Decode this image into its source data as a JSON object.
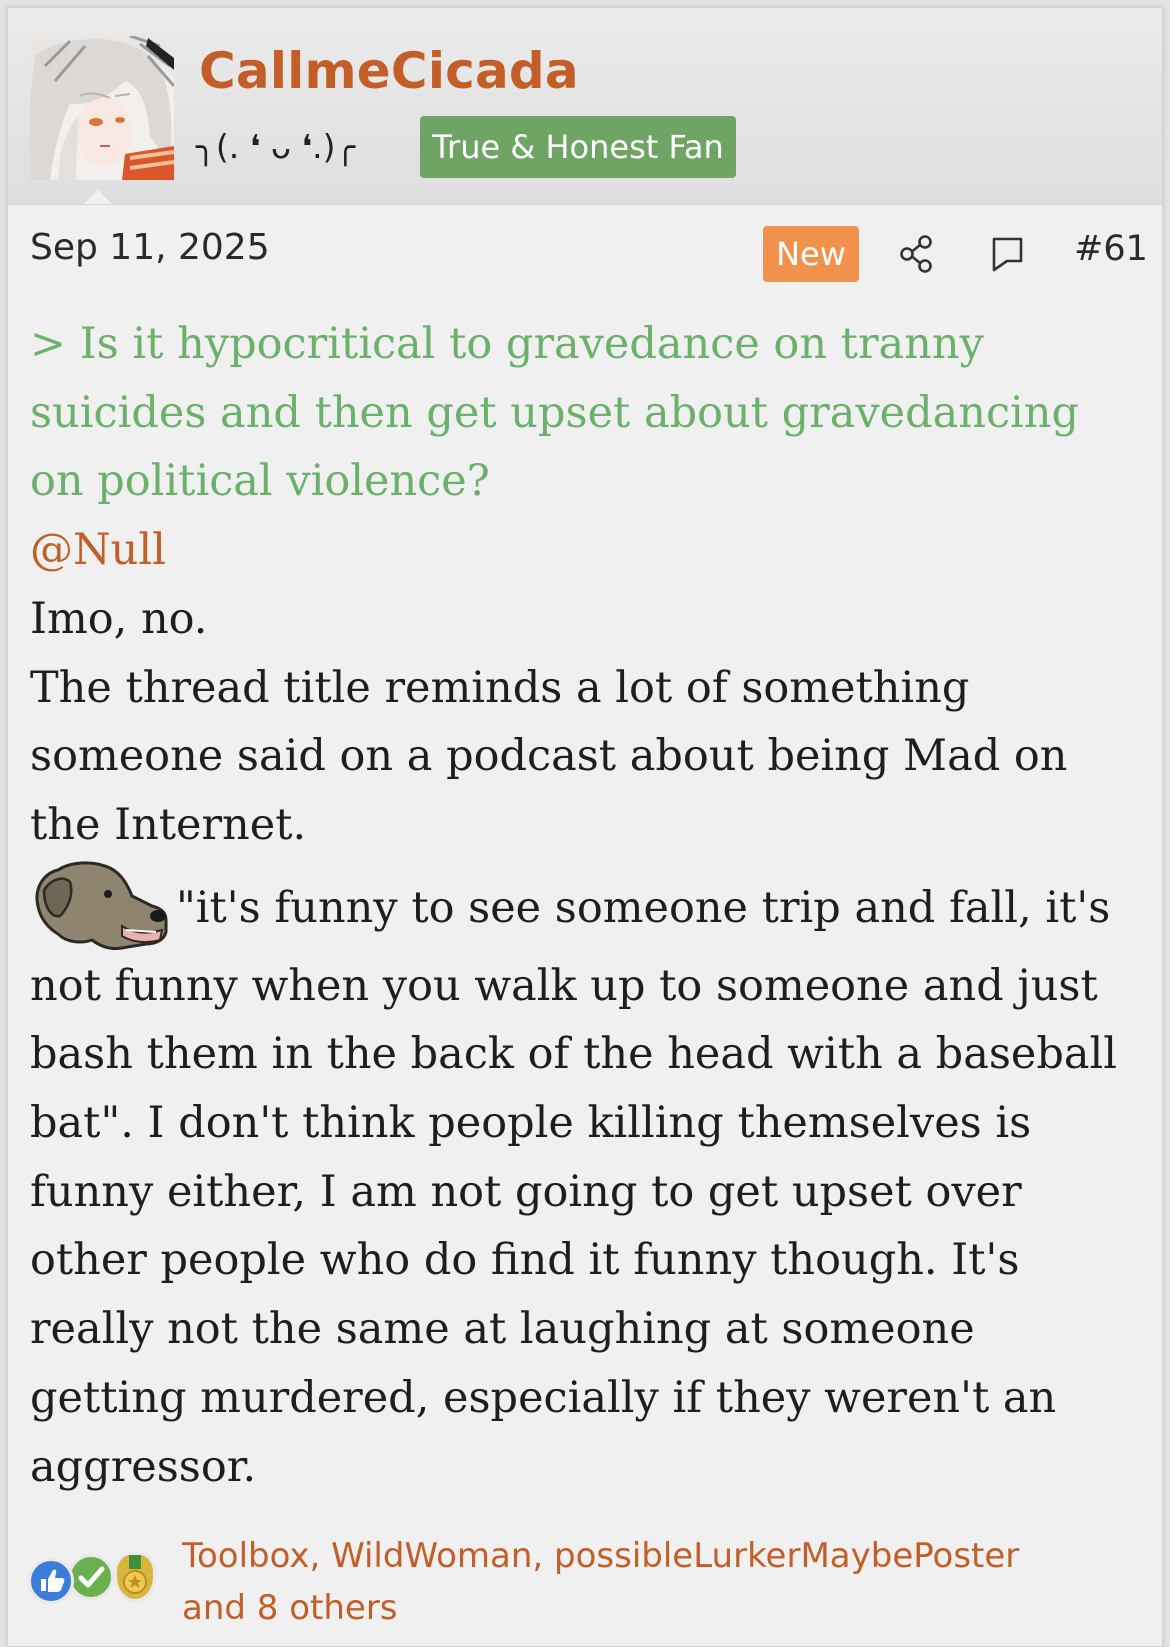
{
  "post": {
    "user": {
      "username": "CallmeCicada",
      "title": "╮(. ❛ ᴗ ❛.)╭",
      "banner": "True & Honest Fan"
    },
    "meta": {
      "date": "Sep 11, 2025",
      "new_badge": "New",
      "post_number": "#61"
    },
    "message": {
      "quote_lines": [
        "> Is it hypocritical to gravedance on tranny",
        "suicides and then get upset about gravedancing",
        "on political violence?"
      ],
      "mention": "@Null",
      "body_lines": [
        "Imo, no.",
        "The thread title reminds a lot of something",
        "someone said on a podcast about being Mad on",
        "the Internet.",
        "\"it's funny to see someone trip and fall, it's",
        "not funny when you walk up to someone and just",
        "bash them in the back of the head with a baseball",
        "bat\". I don't think people killing themselves is",
        "funny either, I am not going to get upset over",
        "other people who do find it funny though. It's",
        "really not the same at laughing at someone",
        "getting murdered, especially if they weren't an",
        "aggressor."
      ]
    },
    "reactions": {
      "icons": [
        "like-icon",
        "check-icon",
        "medal-icon"
      ],
      "users_line1": "Toolbox, WildWoman, possibleLurkerMaybePoster",
      "users_line2": "and 8 others"
    },
    "colors": {
      "accent": "#c25f28",
      "quote": "#6bb16b",
      "banner": "#6fa564",
      "new_badge": "#f0914c"
    }
  }
}
